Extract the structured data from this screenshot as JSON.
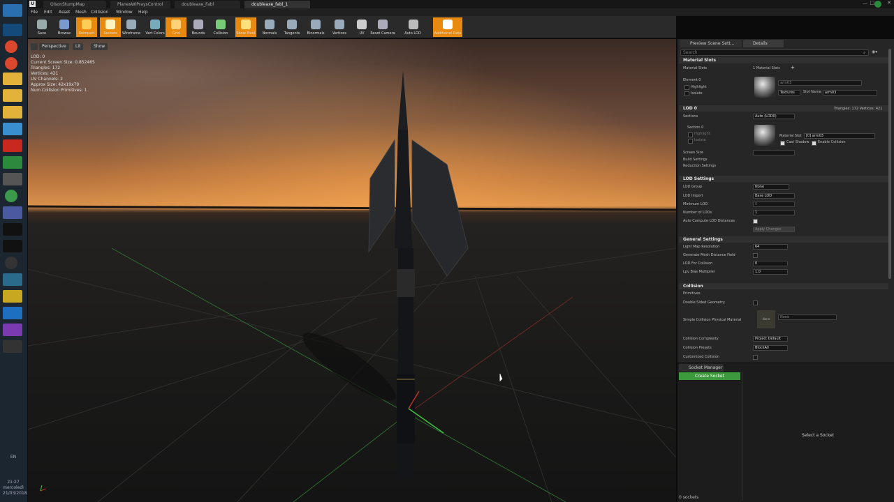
{
  "window": {
    "tabs": [
      "OlsonStumpMap",
      "PlanesWIPraysControl",
      "doubleaxe_Fabl",
      "doubleaxe_fabl_1"
    ]
  },
  "menus": [
    "File",
    "Edit",
    "Asset",
    "Mesh",
    "Collision",
    "Window",
    "Help"
  ],
  "toolbar": [
    {
      "label": "Save",
      "icon": "save-icon",
      "on": false
    },
    {
      "label": "Browse",
      "icon": "browse-icon",
      "on": false
    },
    {
      "label": "Reimport",
      "icon": "reimport-icon",
      "on": true
    },
    {
      "label": "Sockets",
      "icon": "sockets-icon",
      "on": true
    },
    {
      "label": "Wireframe",
      "icon": "wireframe-icon",
      "on": false
    },
    {
      "label": "Vert Colors",
      "icon": "vert-colors-icon",
      "on": false
    },
    {
      "label": "Grid",
      "icon": "grid-icon",
      "on": true
    },
    {
      "label": "Bounds",
      "icon": "bounds-icon",
      "on": false
    },
    {
      "label": "Collision",
      "icon": "collision-icon",
      "on": false
    },
    {
      "label": "Show Pivot",
      "icon": "pivot-icon",
      "on": true
    },
    {
      "label": "Normals",
      "icon": "normals-icon",
      "on": false
    },
    {
      "label": "Tangents",
      "icon": "tangents-icon",
      "on": false
    },
    {
      "label": "Binormals",
      "icon": "binormals-icon",
      "on": false
    },
    {
      "label": "Vertices",
      "icon": "vertices-icon",
      "on": false
    },
    {
      "label": "UV",
      "icon": "uv-icon",
      "on": false
    },
    {
      "label": "Reset Camera",
      "icon": "camera-icon",
      "on": false
    },
    {
      "label": "Auto LOD",
      "icon": "lod-icon",
      "on": false
    },
    {
      "label": "Additional Data",
      "icon": "data-icon",
      "on": true
    }
  ],
  "viewport": {
    "buttons": [
      "Perspective",
      "Lit",
      "Show"
    ],
    "stats": [
      "LOD: 0",
      "Current Screen Size: 0.852465",
      "Triangles: 172",
      "Vertices: 421",
      "UV Channels: 2",
      "Approx Size: 42x19x79",
      "Num Collision Primitives: 1"
    ]
  },
  "details": {
    "tabs": [
      "Preview Scene Sett...",
      "Details"
    ],
    "search_placeholder": "Search",
    "material_slots": {
      "title": "Material Slots",
      "label": "Material Slots",
      "count": "1 Material Slots",
      "element": "Element 0",
      "highlight": "Highlight",
      "isolate": "Isolate",
      "textures": "Textures",
      "slot_name_label": "Slot Name",
      "slot_name": "arm03"
    },
    "lod0": {
      "title": "LOD 0",
      "summary": "Triangles: 172   Vertices: 421",
      "sections": "Sections",
      "section0": "Section 0",
      "mode": "Auto (LOD0)",
      "material_slot_label": "Material Slot",
      "material_slot": "[0] arm03",
      "cast_shadow": "Cast Shadow",
      "enable_collision": "Enable Collision",
      "screen_size": "Screen Size",
      "build_settings": "Build Settings",
      "reduction_settings": "Reduction Settings"
    },
    "lod_settings": {
      "title": "LOD Settings",
      "rows": [
        {
          "label": "LOD Group",
          "value": "None"
        },
        {
          "label": "LOD Import",
          "value": "Base LOD"
        },
        {
          "label": "Minimum LOD",
          "value": "0"
        },
        {
          "label": "Number of LODs",
          "value": "1"
        }
      ],
      "auto_compute": "Auto Compute LOD Distances",
      "apply": "Apply Changes"
    },
    "general": {
      "title": "General Settings",
      "rows": [
        {
          "label": "Light Map Resolution",
          "value": "64"
        },
        {
          "label": "Generate Mesh Distance Field",
          "value": ""
        },
        {
          "label": "LOD For Collision",
          "value": "0"
        },
        {
          "label": "Lpv Bias Multiplier",
          "value": "1.0"
        }
      ]
    },
    "collision": {
      "title": "Collision",
      "primitives": "Primitives",
      "double_sided": "Double Sided Geometry",
      "phys_mat_label": "Simple Collision Physical Material",
      "phys_mat": "None",
      "complexity_label": "Collision Complexity",
      "complexity": "Project Default",
      "presets_label": "Collision Presets",
      "presets": "BlockAll",
      "customized": "Customized Collision"
    }
  },
  "socket_manager": {
    "tab": "Socket Manager",
    "create": "Create Socket",
    "select": "Select a Socket",
    "count": "0 sockets"
  },
  "taskbar": {
    "lang": "EN",
    "time": "21:27",
    "day": "mercoledì",
    "date": "21/03/2018"
  },
  "colors": {
    "accent": "#e88a10",
    "green": "#4caf50"
  }
}
